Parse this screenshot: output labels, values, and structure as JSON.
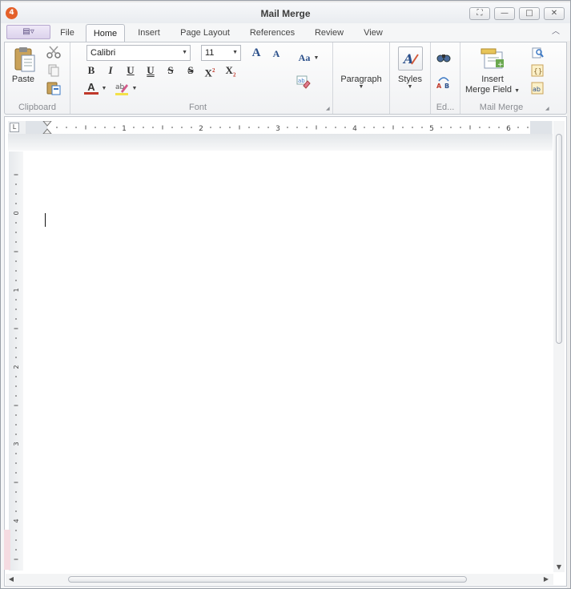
{
  "window": {
    "title": "Mail Merge",
    "app_icon_glyph": "4",
    "app_menu_glyph": "▤▿",
    "buttons": {
      "restore": "⛶",
      "minimize": "—",
      "maximize": "□",
      "close": "✕"
    }
  },
  "tabs": [
    "File",
    "Home",
    "Insert",
    "Page Layout",
    "References",
    "Review",
    "View"
  ],
  "active_tab": "Home",
  "ribbon": {
    "clipboard": {
      "paste_label": "Paste",
      "group_label": "Clipboard"
    },
    "font": {
      "font_name": "Calibri",
      "font_size": "11",
      "grow_font": "A",
      "shrink_font": "A",
      "change_case": "Aa",
      "bold": "B",
      "italic": "I",
      "underline": "U",
      "double_underline": "U",
      "strikethrough": "S",
      "double_strikethrough": "S",
      "superscript": "X",
      "superscript_mark": "2",
      "subscript": "X",
      "subscript_mark": "2",
      "font_color": "A",
      "group_label": "Font"
    },
    "paragraph": {
      "label": "Paragraph"
    },
    "styles": {
      "label": "Styles"
    },
    "editing": {
      "group_label": "Ed..."
    },
    "mail_merge": {
      "insert_line1": "Insert",
      "insert_line2": "Merge Field",
      "group_label": "Mail Merge"
    }
  },
  "ruler": {
    "corner_glyph": "L",
    "h_numbers": [
      "1",
      "2",
      "3",
      "4",
      "5",
      "6"
    ],
    "v_numbers": [
      "0",
      "1",
      "2",
      "3",
      "4"
    ]
  },
  "colors": {
    "accent_orange": "#e4602a",
    "ribbon_border": "#c4c8cf",
    "app_menu": "#dcd2ec"
  }
}
